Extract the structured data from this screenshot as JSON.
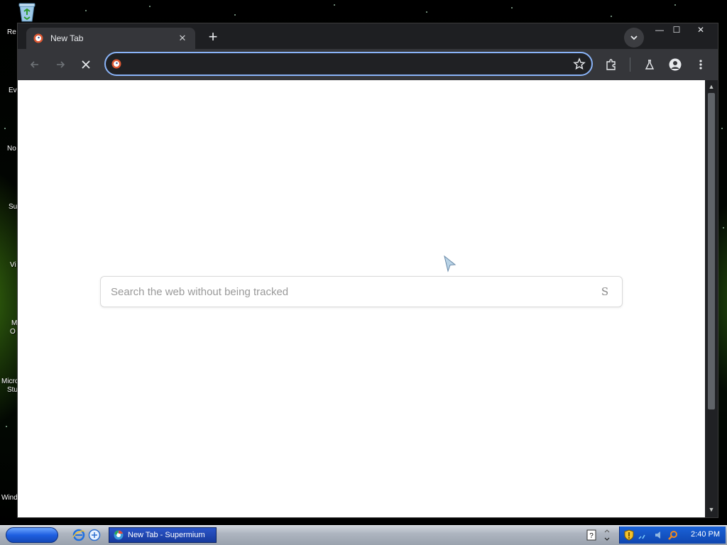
{
  "desktop": {
    "icon_labels": [
      "Re",
      "Ev",
      "No",
      "Su",
      "Vi",
      "M",
      "O",
      "Micro",
      "Stu",
      "Wind"
    ]
  },
  "browser": {
    "tab_title": "New Tab",
    "tab_close": "✕",
    "new_tab": "+",
    "window_controls": {
      "minimize": "—",
      "maximize": "☐",
      "close": "✕"
    },
    "omnibox_value": "",
    "page": {
      "search_placeholder": "Search the web without being tracked",
      "search_submit": "S"
    }
  },
  "taskbar": {
    "task_label": "New Tab - Supermium",
    "clock": "2:40 PM"
  },
  "icons": {
    "recycle_bin": "recycle-bin-icon",
    "tab_favicon": "ddg-favicon-icon",
    "back": "back-arrow-icon",
    "forward": "forward-arrow-icon",
    "stop": "stop-icon",
    "bookmark": "star-icon",
    "extensions": "puzzle-icon",
    "labs": "flask-icon",
    "profile": "person-icon",
    "menu": "kebab-menu-icon",
    "tab_search": "chevron-down-icon"
  },
  "colors": {
    "omnibox_focus": "#8ab4f8",
    "tab_active": "#35363a",
    "titlebar": "#1e1f22",
    "taskbar_active": "#173a9c",
    "tray": "#1a62d8"
  }
}
